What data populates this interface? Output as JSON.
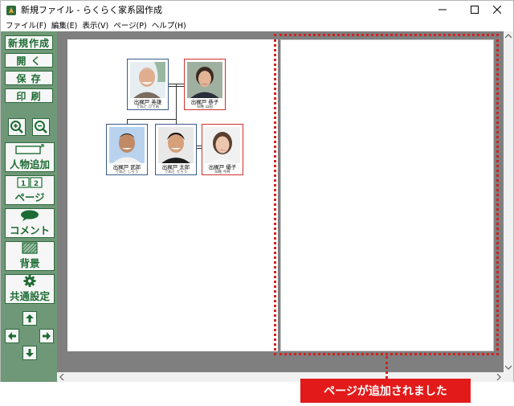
{
  "window": {
    "title": "新規ファイル - らくらく家系図作成"
  },
  "menu": {
    "items": [
      "ファイル(F)",
      "編集(E)",
      "表示(V)",
      "ページ(P)",
      "ヘルプ(H)"
    ]
  },
  "toolbar": {
    "new_label": "新規作成",
    "open_label": "開 く",
    "save_label": "保 存",
    "print_label": "印 刷",
    "add_person_label": "人物追加",
    "page_label": "ページ",
    "page_icon_digits": [
      "1",
      "2"
    ],
    "comment_label": "コメント",
    "background_label": "背景",
    "common_settings_label": "共通設定"
  },
  "family": {
    "people": [
      {
        "name": "出梶戸 英雄",
        "sub": "でねと ひでお",
        "gender": "male"
      },
      {
        "name": "出梶戸 恭子",
        "sub": "旧姓 山田",
        "gender": "female"
      },
      {
        "name": "出梶戸 武郎",
        "sub": "でねと しろう",
        "gender": "male"
      },
      {
        "name": "出梶戸 太郎",
        "sub": "でねと たろう",
        "gender": "male"
      },
      {
        "name": "出梶戸 優子",
        "sub": "旧姓 今井",
        "gender": "female"
      }
    ]
  },
  "annotation": {
    "callout_text": "ページが追加されました"
  },
  "colors": {
    "toolbar_bg": "#6e9877",
    "button_text": "#1d6b34",
    "canvas_bg": "#7f7f7f",
    "highlight_red": "#e31a1a",
    "male_border": "#3a5a8a",
    "female_border": "#d03030"
  }
}
